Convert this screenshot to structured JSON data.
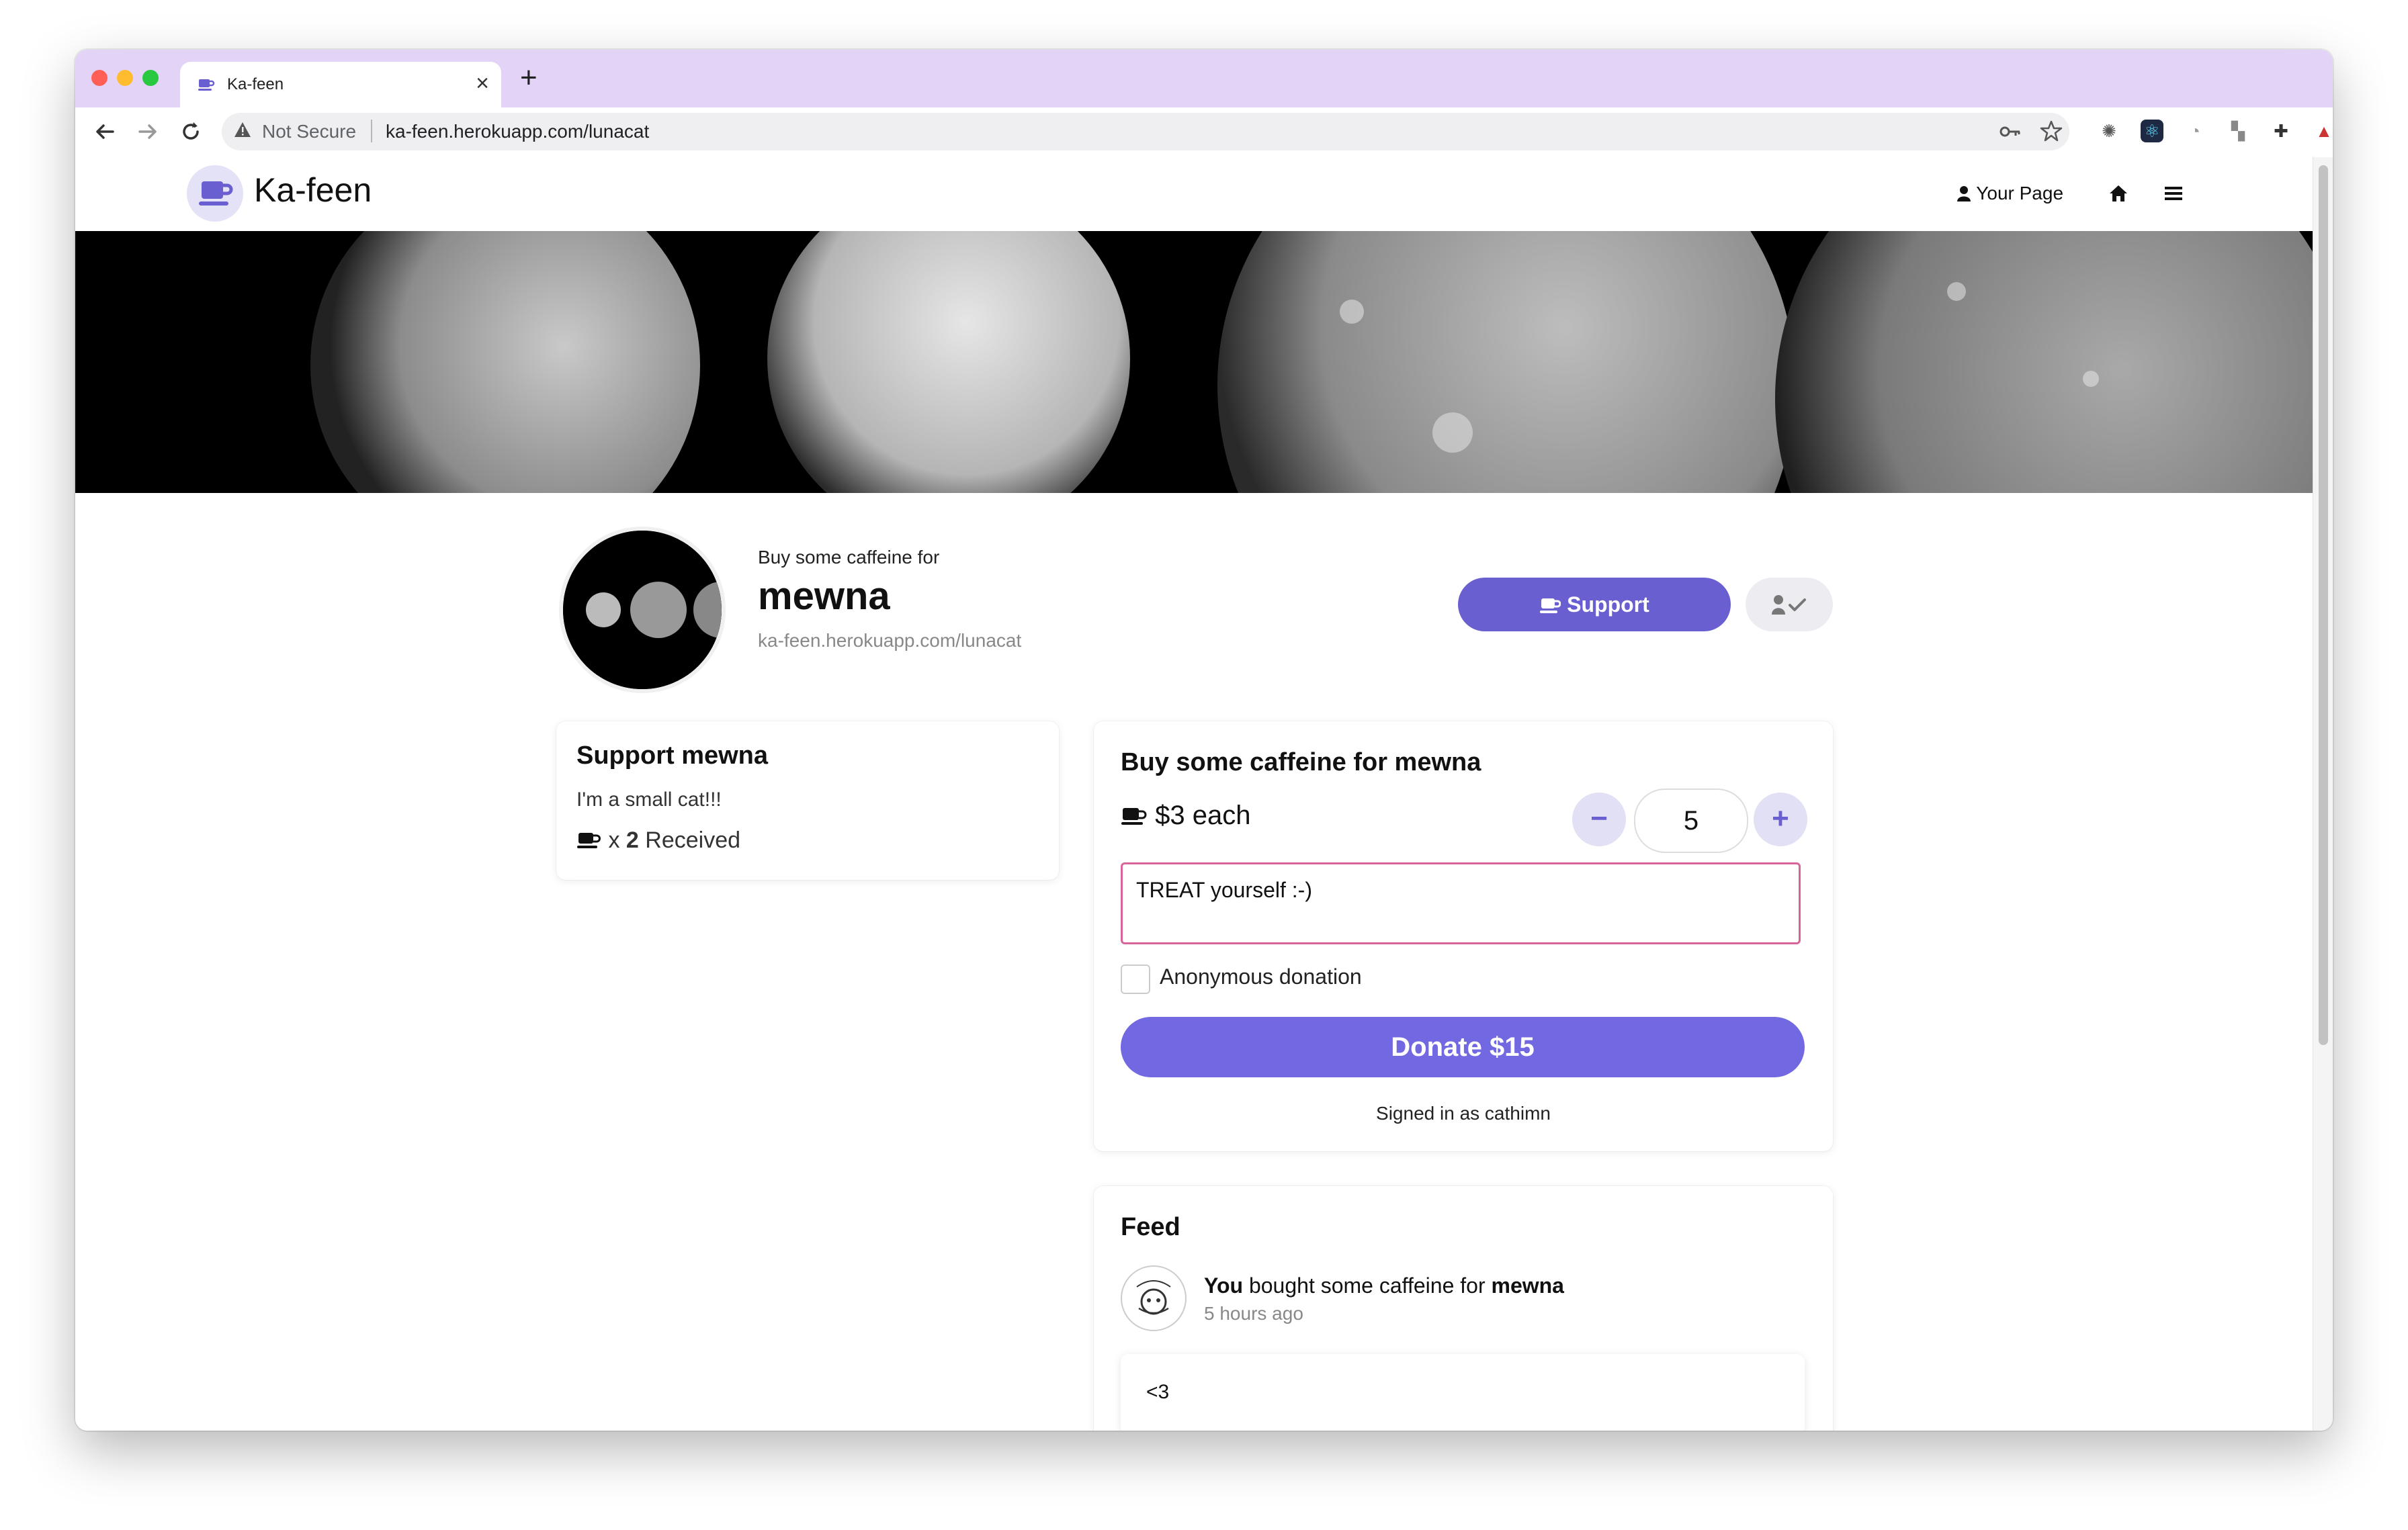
{
  "browser": {
    "tab_title": "Ka-feen",
    "close_glyph": "×",
    "new_tab_glyph": "+",
    "security_label": "Not Secure",
    "url": "ka-feen.herokuapp.com/lunacat",
    "tab_bar_color": "#e3d4f7"
  },
  "site": {
    "logo_text": "Ka-feen",
    "nav": {
      "your_page": "Your Page",
      "home_icon": "home-icon",
      "menu_icon": "hamburger-menu-icon"
    },
    "accent_color": "#6a5fd1"
  },
  "profile": {
    "prelabel": "Buy some caffeine for",
    "name": "mewna",
    "url": "ka-feen.herokuapp.com/lunacat",
    "support_label": "Support",
    "follow_icon": "user-check-icon"
  },
  "about_card": {
    "title": "Support mewna",
    "bio": "I'm a small cat!!!",
    "received_prefix": "x ",
    "received_count": "2",
    "received_suffix": " Received"
  },
  "donate_card": {
    "title": "Buy some caffeine for mewna",
    "price_label": "$3 each",
    "minus": "−",
    "plus": "+",
    "quantity": "5",
    "message": "TREAT yourself :-)",
    "anonymous_label": "Anonymous donation",
    "anonymous_checked": false,
    "donate_label": "Donate $15",
    "signed_in": "Signed in as cathimn"
  },
  "feed": {
    "title": "Feed",
    "items": [
      {
        "actor": "You",
        "action": " bought some caffeine for ",
        "target": "mewna",
        "time": "5 hours ago",
        "message": "<3"
      }
    ]
  }
}
